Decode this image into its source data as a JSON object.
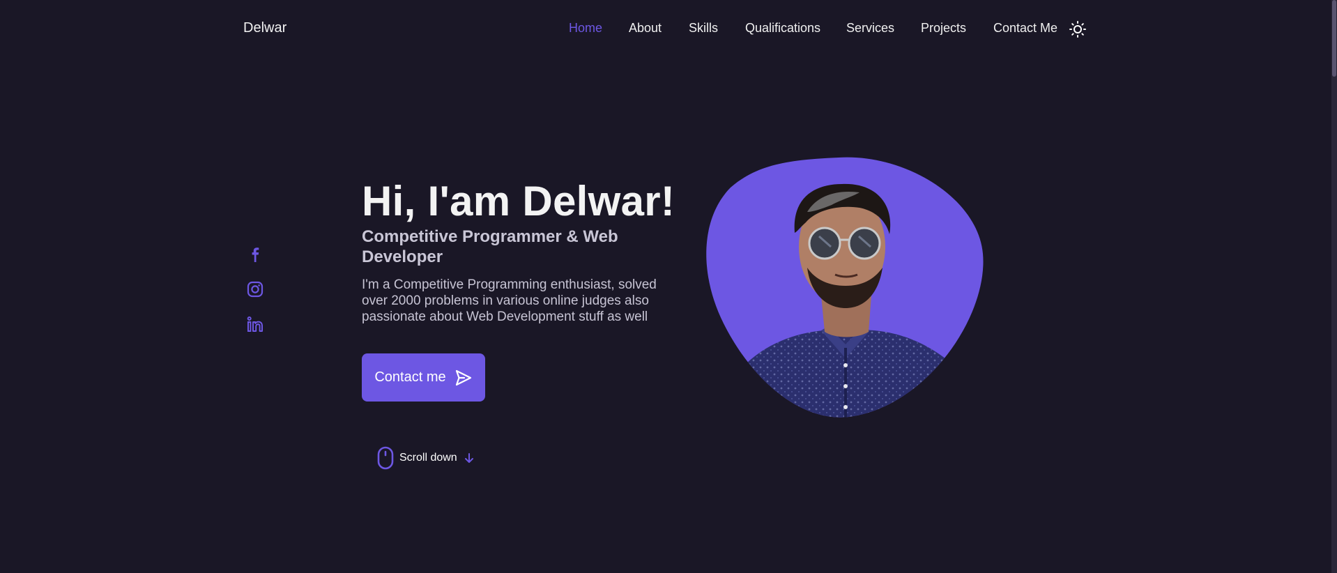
{
  "header": {
    "logo": "Delwar",
    "nav": [
      {
        "label": "Home",
        "active": true
      },
      {
        "label": "About",
        "active": false
      },
      {
        "label": "Skills",
        "active": false
      },
      {
        "label": "Qualifications",
        "active": false
      },
      {
        "label": "Services",
        "active": false
      },
      {
        "label": "Projects",
        "active": false
      },
      {
        "label": "Contact Me",
        "active": false
      }
    ],
    "theme_toggle_icon": "sun-icon"
  },
  "social": [
    {
      "icon": "facebook-icon"
    },
    {
      "icon": "instagram-icon"
    },
    {
      "icon": "linkedin-icon"
    }
  ],
  "hero": {
    "title": "Hi, I'am Delwar!",
    "subtitle": "Competitive Programmer & Web Developer",
    "description": "I'm a Competitive Programming enthusiast, solved over 2000 problems in various online judges also passionate about Web Development stuff as well",
    "contact_button": "Contact me",
    "contact_icon": "send-icon",
    "scroll_label": "Scroll down",
    "scroll_icon": "mouse-icon",
    "scroll_arrow_icon": "arrow-down-icon"
  },
  "colors": {
    "background": "#1a1726",
    "accent": "#6d57e3",
    "text": "#f3f3f3",
    "muted": "#c9c6d6"
  }
}
